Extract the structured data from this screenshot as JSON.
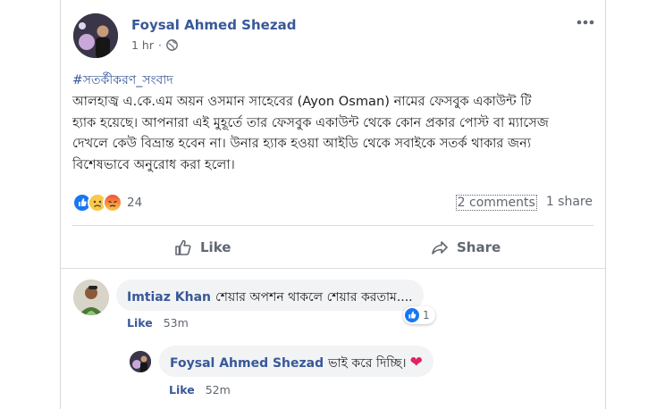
{
  "post": {
    "author": "Foysal Ahmed Shezad",
    "time": "1 hr",
    "privacy_icon": "globe-icon",
    "hashtag": "#সতর্কীকরণ_সংবাদ",
    "text_lines": [
      "আলহাজ্ব এ.কে.এম অয়ন ওসমান সাহেবের (Ayon Osman) নামের ফেসবুক একাউন্ট টি",
      "হ্যাক হয়েছে। আপনারা এই মুহূর্তে তার ফেসবুক একাউন্ট থেকে কোন প্রকার পোস্ট বা ম্যাসেজ",
      "দেখলে কেউ বিভ্রান্ত হবেন না। উনার হ্যাক হওয়া আইডি থেকে সবাইকে সতর্ক থাকার জন্য",
      "বিশেষভাবে অনুরোধ করা হলো।"
    ],
    "reaction_count": "24",
    "reaction_icons": [
      "like-reaction-icon",
      "sad-reaction-icon",
      "angry-reaction-icon"
    ],
    "comments_count": "2 comments",
    "shares_count": "1 share"
  },
  "actions": {
    "like_label": "Like",
    "share_label": "Share"
  },
  "comments": [
    {
      "author": "Imtiaz Khan",
      "text": "শেয়ার অপশন থাকলে শেয়ার করতাম....",
      "like_label": "Like",
      "time": "53m",
      "reaction_count": "1"
    },
    {
      "author": "Foysal Ahmed Shezad",
      "text": "ভাই করে দিচ্ছি।",
      "emoji": "❤",
      "like_label": "Like",
      "time": "52m"
    }
  ],
  "colors": {
    "link": "#385898",
    "secondary": "#606770",
    "like_blue": "#1877f2",
    "angry": "#f0523a",
    "sad": "#f7c84a"
  }
}
